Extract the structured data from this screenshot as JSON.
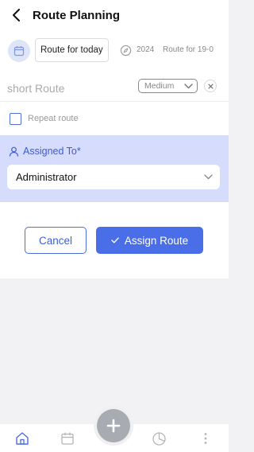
{
  "header": {
    "title": "Route Planning",
    "back_icon": "chevron-left-icon"
  },
  "route_chips": {
    "calendar_icon": "calendar-icon",
    "name": "Route for today",
    "compass_icon": "compass-icon",
    "year": "2024",
    "description": "Route for 19-0"
  },
  "route_type": "short Route",
  "priority": {
    "selected": "Medium"
  },
  "repeat": {
    "label": "Repeat route",
    "checked": false
  },
  "assigned": {
    "label": "Assigned To*",
    "selected": "Administrator"
  },
  "actions": {
    "cancel": "Cancel",
    "assign": "Assign Route"
  },
  "bottom_nav": {
    "items": [
      "home-icon",
      "calendar-icon",
      "add-icon",
      "pie-chart-icon",
      "more-vertical-icon"
    ],
    "active": "home-icon"
  },
  "colors": {
    "accent": "#4a6ee8",
    "assigned_bg": "#d6dcfb",
    "page_bg": "#f2f2f4"
  }
}
